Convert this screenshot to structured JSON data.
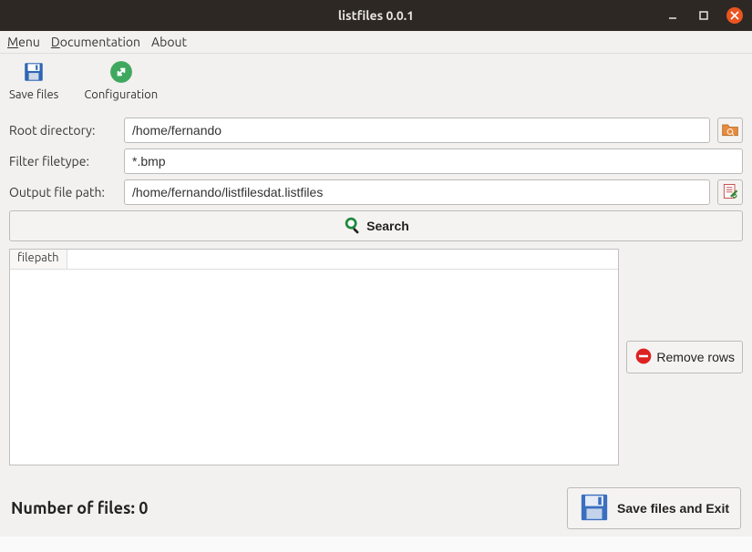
{
  "window": {
    "title": "listfiles 0.0.1"
  },
  "menu": {
    "menu": "Menu",
    "documentation": "Documentation",
    "about": "About"
  },
  "toolbar": {
    "save_files": "Save files",
    "configuration": "Configuration"
  },
  "form": {
    "root_label": "Root directory:",
    "root_value": "/home/fernando",
    "filter_label": "Filter filetype:",
    "filter_value": "*.bmp",
    "output_label": "Output file path:",
    "output_value": "/home/fernando/listfilesdat.listfiles"
  },
  "buttons": {
    "search": "Search",
    "remove_rows": "Remove rows",
    "save_exit": "Save files and Exit"
  },
  "table": {
    "col_filepath": "filepath"
  },
  "status": {
    "count_label": "Number of files: ",
    "count_value": "0"
  },
  "colors": {
    "accent": "#e95420",
    "toolbar_bg": "#f2f1f0",
    "titlebar_bg": "#2d2824"
  }
}
